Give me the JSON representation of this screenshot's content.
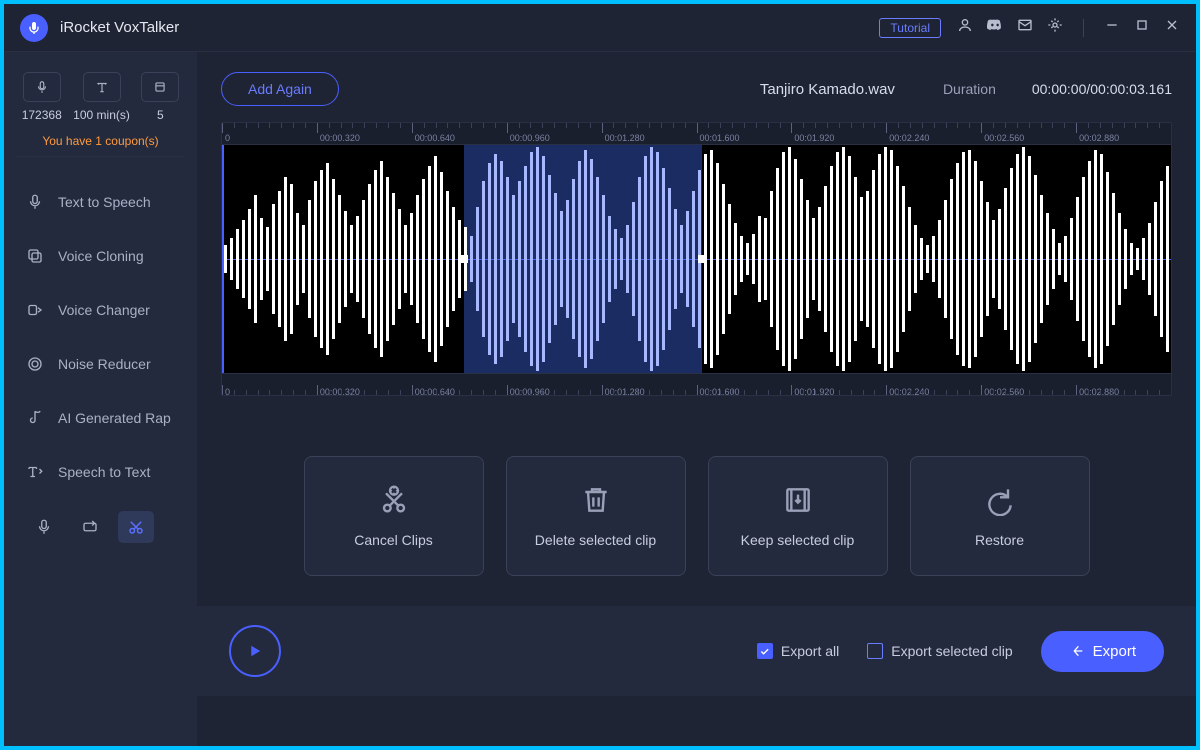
{
  "app": {
    "title": "iRocket VoxTalker",
    "tutorial_label": "Tutorial"
  },
  "stats": {
    "credits": "172368",
    "minutes": "100 min(s)",
    "count": "5",
    "coupon_text": "You have 1 coupon(s)"
  },
  "nav": {
    "items": [
      {
        "label": "Text to Speech"
      },
      {
        "label": "Voice Cloning"
      },
      {
        "label": "Voice Changer"
      },
      {
        "label": "Noise Reducer"
      },
      {
        "label": "AI Generated Rap"
      },
      {
        "label": "Speech to Text"
      }
    ]
  },
  "header": {
    "add_again": "Add Again",
    "filename": "Tanjiro Kamado.wav",
    "duration_label": "Duration",
    "duration_value": "00:00:00/00:00:03.161"
  },
  "ruler": {
    "labels": [
      "0",
      "00:00.320",
      "00:00.640",
      "00:00.960",
      "00:01.280",
      "00:01.600",
      "00:01.920",
      "00:02.240",
      "00:02.560",
      "00:02.880"
    ]
  },
  "waveform": {
    "selection_start_pct": 25.5,
    "selection_end_pct": 50.6,
    "bars": [
      12,
      18,
      26,
      34,
      44,
      56,
      36,
      28,
      48,
      60,
      72,
      66,
      40,
      30,
      52,
      68,
      78,
      84,
      70,
      56,
      42,
      30,
      38,
      52,
      66,
      78,
      86,
      72,
      58,
      44,
      30,
      40,
      56,
      70,
      82,
      90,
      76,
      60,
      46,
      34,
      28,
      20,
      46,
      68,
      84,
      92,
      86,
      72,
      56,
      68,
      82,
      94,
      98,
      90,
      74,
      58,
      42,
      52,
      70,
      86,
      96,
      88,
      72,
      56,
      38,
      26,
      18,
      30,
      50,
      72,
      90,
      98,
      94,
      80,
      62,
      44,
      30,
      42,
      60,
      78,
      92,
      96,
      84,
      66,
      48,
      32,
      20,
      14,
      22,
      38,
      36,
      60,
      80,
      94,
      98,
      88,
      70,
      52,
      36,
      46,
      64,
      82,
      94,
      98,
      90,
      72,
      54,
      60,
      78,
      92,
      98,
      96,
      82,
      64,
      46,
      30,
      18,
      12,
      20,
      34,
      52,
      70,
      84,
      94,
      96,
      86,
      68,
      50,
      34,
      44,
      62,
      80,
      92,
      98,
      90,
      74,
      56,
      40,
      26,
      14,
      20,
      36,
      54,
      72,
      86,
      96,
      92,
      76,
      58,
      40,
      26,
      14,
      10,
      18,
      32,
      50,
      68,
      82
    ]
  },
  "clips": {
    "cancel": "Cancel Clips",
    "delete": "Delete selected clip",
    "keep": "Keep selected clip",
    "restore": "Restore"
  },
  "footer": {
    "export_all": "Export all",
    "export_selected": "Export selected clip",
    "export_btn": "Export",
    "export_all_checked": true,
    "export_selected_checked": false
  }
}
